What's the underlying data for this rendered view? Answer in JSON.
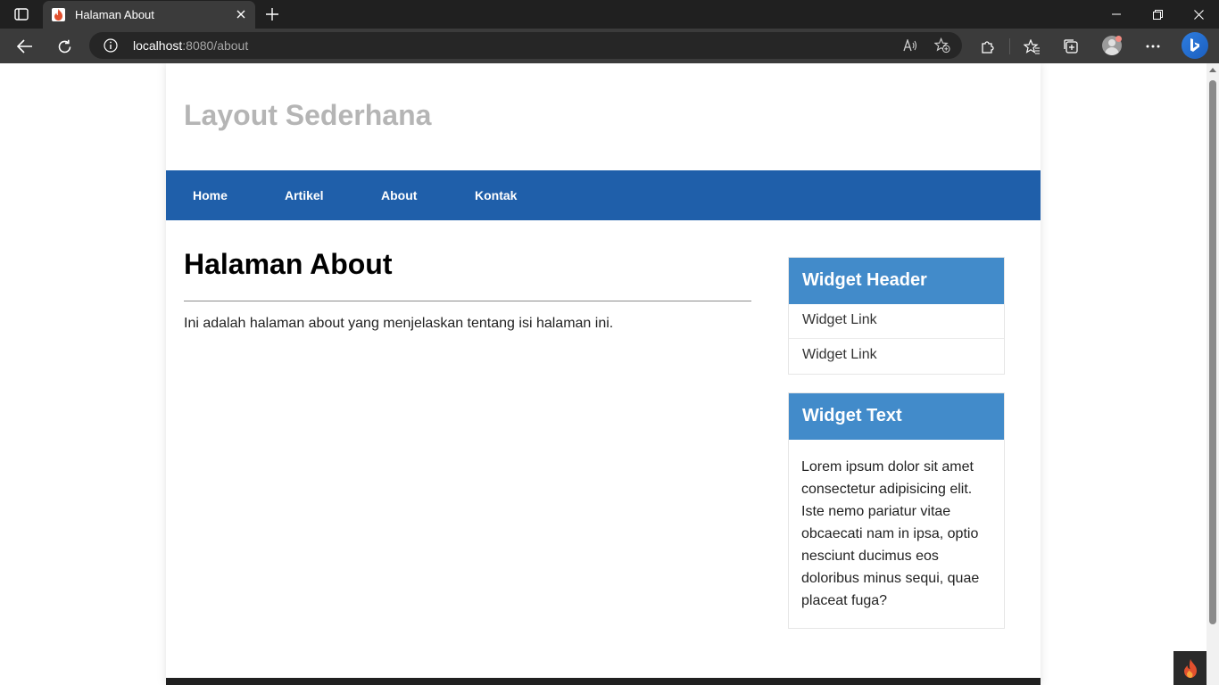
{
  "browser": {
    "tab_title": "Halaman About",
    "url_host": "localhost",
    "url_path": ":8080/about"
  },
  "site": {
    "title": "Layout Sederhana",
    "nav": [
      "Home",
      "Artikel",
      "About",
      "Kontak"
    ]
  },
  "main": {
    "heading": "Halaman About",
    "body": "Ini adalah halaman about yang menjelaskan tentang isi halaman ini."
  },
  "sidebar": {
    "widget_links": {
      "header": "Widget Header",
      "links": [
        "Widget Link",
        "Widget Link"
      ]
    },
    "widget_text": {
      "header": "Widget Text",
      "body": "Lorem ipsum dolor sit amet consectetur adipisicing elit. Iste nemo pariatur vitae obcaecati nam in ipsa, optio nesciunt ducimus eos doloribus minus sequi, quae placeat fuga?"
    }
  },
  "colors": {
    "nav_bg": "#1f5faa",
    "widget_header_bg": "#428bca",
    "site_title": "#b5b5b5"
  },
  "icons": [
    "tab-actions-icon",
    "flame-favicon-icon",
    "close-icon",
    "plus-icon",
    "minimize-icon",
    "restore-icon",
    "back-icon",
    "refresh-icon",
    "info-icon",
    "read-aloud-icon",
    "add-favorite-icon",
    "extensions-icon",
    "favorites-icon",
    "collections-icon",
    "more-icon",
    "bing-icon",
    "codeigniter-icon"
  ]
}
